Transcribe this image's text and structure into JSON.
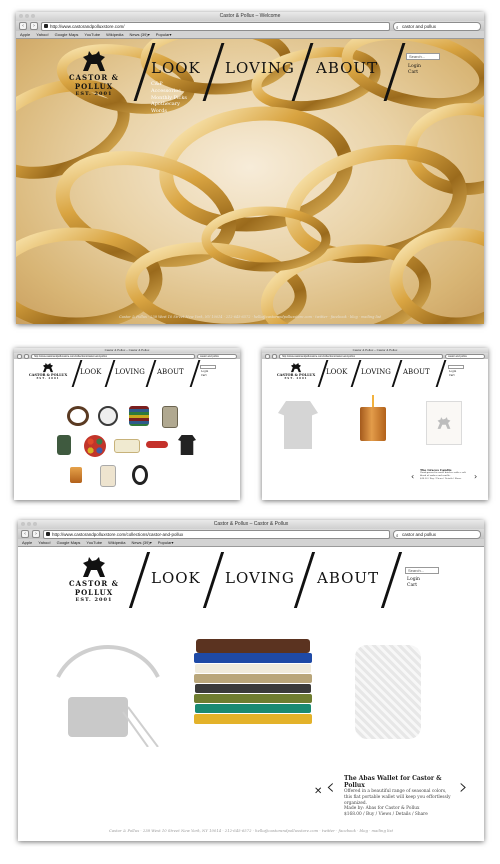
{
  "brand": {
    "name": "CASTOR & POLLUX",
    "est": "EST. 2001"
  },
  "nav": {
    "look": "LOOK",
    "loving": "LOVING",
    "about": "ABOUT"
  },
  "submenu": [
    "C&P",
    "Accessories",
    "Monthly Picks",
    "Apothecary",
    "Words"
  ],
  "search": {
    "placeholder": "Search..."
  },
  "account": {
    "login": "Login",
    "cart": "Cart"
  },
  "footer": "Castor & Pollux · 238 West 10 Street New York, NY 10014 · 212-645-6572 · hello@castorandpolluxstore.com · twitter · facebook · blog · mailing list",
  "shot1": {
    "window_title": "Castor & Pollux – Welcome",
    "url": "http://www.castorandpolluxstore.com/",
    "search_query": "castor and pollux",
    "bookmarks": [
      "Apple",
      "Yahoo!",
      "Google Maps",
      "YouTube",
      "Wikipedia",
      "News (39)▾",
      "Popular▾"
    ]
  },
  "shot2": {
    "window_title": "Castor & Pollux – Castor & Pollux",
    "url": "http://www.castorandpolluxstore.com/collections/castor-and-pollux",
    "search_query": "castor and pollux"
  },
  "shot3": {
    "window_title": "Castor & Pollux – Castor & Pollux",
    "url": "http://www.castorandpolluxstore.com/collections/castor-and-pollux",
    "search_query": "castor and pollux",
    "product_title": "The Graces Candle",
    "product_desc": "Hand-poured in small batches with a soft blend of amber and vanilla.",
    "product_links": "$48.00 / Buy / Views / Details / Share"
  },
  "shot4": {
    "window_title": "Castor & Pollux – Castor & Pollux",
    "url": "http://www.castorandpolluxstore.com/collections/castor-and-pollux",
    "search_query": "castor and pollux",
    "bookmarks": [
      "Apple",
      "Yahoo!",
      "Google Maps",
      "YouTube",
      "Wikipedia",
      "News (39)▾",
      "Popular▾"
    ],
    "product_title": "The Abas Wallet for Castor & Pollux",
    "product_desc": "Offered in a beautiful range of seasonal colors, this flat portable wallet will keep you effortlessly organized.",
    "product_maker": "Made by: Abas for Castor & Pollux",
    "product_links": "$168.00 / Buy / Views / Details / Share",
    "close_symbol": "✕"
  },
  "colors": {
    "gold": "#c99b3b",
    "ink": "#111111",
    "footer": "#999999"
  },
  "icons": [
    "horse-logo-icon",
    "back-arrow-icon",
    "forward-arrow-icon",
    "search-icon",
    "close-icon"
  ]
}
